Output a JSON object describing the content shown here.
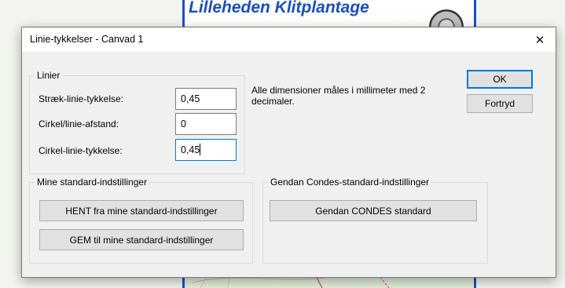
{
  "background": {
    "map_title": "Lilleheden Klitplantage",
    "brand_color": "#1a4fb8"
  },
  "dialog": {
    "title": "Linie-tykkelser - Canvad 1",
    "close_glyph": "✕",
    "info_text": "Alle dimensioner måles i millimeter med 2 decimaler.",
    "buttons": {
      "ok": "OK",
      "cancel": "Fortryd"
    },
    "lines_group": {
      "legend": "Linier",
      "fields": [
        {
          "label": "Stræk-linie-tykkelse:",
          "value": "0,45"
        },
        {
          "label": "Cirkel/linie-afstand:",
          "value": "0"
        },
        {
          "label": "Cirkel-linie-tykkelse:",
          "value": "0,45"
        }
      ]
    },
    "my_defaults_group": {
      "legend": "Mine standard-indstillinger",
      "load_button": "HENT fra mine standard-indstillinger",
      "save_button": "GEM til mine standard-indstillinger"
    },
    "condes_defaults_group": {
      "legend": "Gendan Condes-standard-indstillinger",
      "restore_button": "Gendan CONDES standard"
    },
    "focus_color": "#0078d7"
  }
}
